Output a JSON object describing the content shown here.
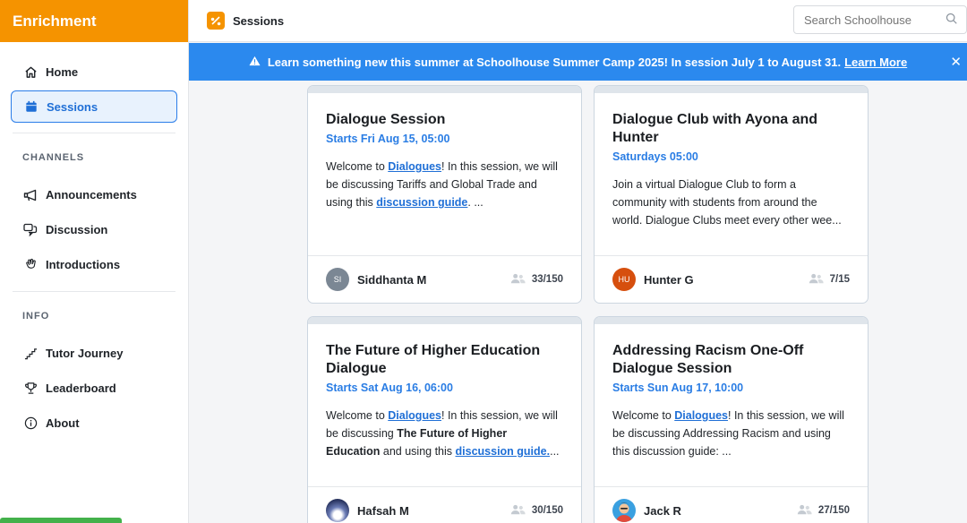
{
  "sidebar": {
    "brand": "Enrichment",
    "nav": [
      {
        "label": "Home",
        "icon": "home-icon"
      },
      {
        "label": "Sessions",
        "icon": "calendar-icon",
        "active": true
      }
    ],
    "channels_label": "CHANNELS",
    "channels": [
      {
        "label": "Announcements",
        "icon": "megaphone-icon"
      },
      {
        "label": "Discussion",
        "icon": "chat-bubbles-icon"
      },
      {
        "label": "Introductions",
        "icon": "wave-hand-icon"
      }
    ],
    "info_label": "INFO",
    "info": [
      {
        "label": "Tutor Journey",
        "icon": "stairs-icon"
      },
      {
        "label": "Leaderboard",
        "icon": "trophy-icon"
      },
      {
        "label": "About",
        "icon": "info-icon"
      }
    ]
  },
  "topbar": {
    "title": "Sessions",
    "search_placeholder": "Search Schoolhouse"
  },
  "banner": {
    "text": "Learn something new this summer at Schoolhouse Summer Camp 2025! In session July 1 to August 31.",
    "link": "Learn More"
  },
  "cards": [
    {
      "title": "Dialogue Session",
      "when": "Starts Fri Aug 15, 05:00",
      "desc": {
        "pre": "Welcome to ",
        "link1": "Dialogues",
        "mid": "! In this session, we will be discussing Tariffs and Global Trade and using this ",
        "link2": "discussion guide",
        "post": ". ..."
      },
      "host": "Siddhanta M",
      "initials": "SI",
      "avatar_color": "#7b8794",
      "count": "33/150"
    },
    {
      "title": "Dialogue Club with Ayona and Hunter",
      "when": "Saturdays 05:00",
      "desc": {
        "pre": "Join a virtual Dialogue Club to form a community with students from around the world. Dialogue Clubs meet every other wee..."
      },
      "host": "Hunter G",
      "initials": "HU",
      "avatar_color": "#d64f0e",
      "count": "7/15"
    },
    {
      "title": "The Future of Higher Education Dialogue",
      "when": "Starts Sat Aug 16, 06:00",
      "desc": {
        "pre": "Welcome to ",
        "link1": "Dialogues",
        "mid": "! In this session, we will be discussing ",
        "bold": "The Future of Higher Education",
        "mid2": " and using this ",
        "link2": "discussion guide.",
        "post": "..."
      },
      "host": "Hafsah M",
      "initials": "",
      "avatar_color": "#4b5b8c",
      "count": "30/150"
    },
    {
      "title": "Addressing Racism One-Off Dialogue Session",
      "when": "Starts Sun Aug 17, 10:00",
      "desc": {
        "pre": "Welcome to ",
        "link1": "Dialogues",
        "mid": "! In this session, we will be discussing Addressing Racism and using this discussion guide: ..."
      },
      "host": "Jack R",
      "initials": "",
      "avatar_color": "#3aa0e0",
      "count": "27/150"
    }
  ]
}
